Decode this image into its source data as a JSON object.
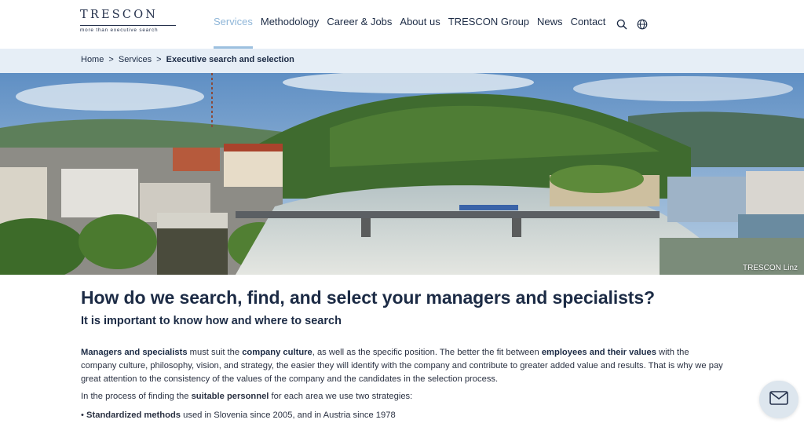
{
  "brand": {
    "name": "TRESCON",
    "tagline": "more than executive search"
  },
  "nav": {
    "items": [
      {
        "label": "Services",
        "active": true
      },
      {
        "label": "Methodology",
        "active": false
      },
      {
        "label": "Career & Jobs",
        "active": false
      },
      {
        "label": "About us",
        "active": false
      },
      {
        "label": "TRESCON Group",
        "active": false
      },
      {
        "label": "News",
        "active": false
      },
      {
        "label": "Contact",
        "active": false
      }
    ],
    "icons": [
      "search-icon",
      "globe-icon"
    ]
  },
  "breadcrumb": {
    "home": "Home",
    "services": "Services",
    "current": "Executive search and selection",
    "separator": ">"
  },
  "hero": {
    "caption": "TRESCON Linz"
  },
  "content": {
    "heading": "How do we search, find, and select your managers and specialists?",
    "subheading": "It is important to know how and where to search",
    "p1": {
      "b1": "Managers and specialists",
      "t1": " must suit the ",
      "b2": "company culture",
      "t2": ", as well as the specific position. The better the fit between ",
      "b3": "employees and their values",
      "t3": " with the company culture, philosophy, vision, and strategy, the easier they will identify with the company and contribute to greater added value and results. That is why we pay great attention to the consistency of the values of the company and the candidates in the selection process."
    },
    "p2": {
      "t1": "In the process of finding the ",
      "b1": "suitable personnel",
      "t2": " for each area we use two strategies:"
    },
    "bullet1": {
      "bullet": "• ",
      "b1": "Standardized methods",
      "t1": " used in Slovenia since 2005, and in Austria since 1978"
    }
  },
  "chat": {
    "icon": "envelope-icon"
  },
  "colors": {
    "text": "#1c2b45",
    "active_nav": "#8fb6d8",
    "crumb_bg": "#e6eef6",
    "chat_bg": "#dde6ee"
  }
}
